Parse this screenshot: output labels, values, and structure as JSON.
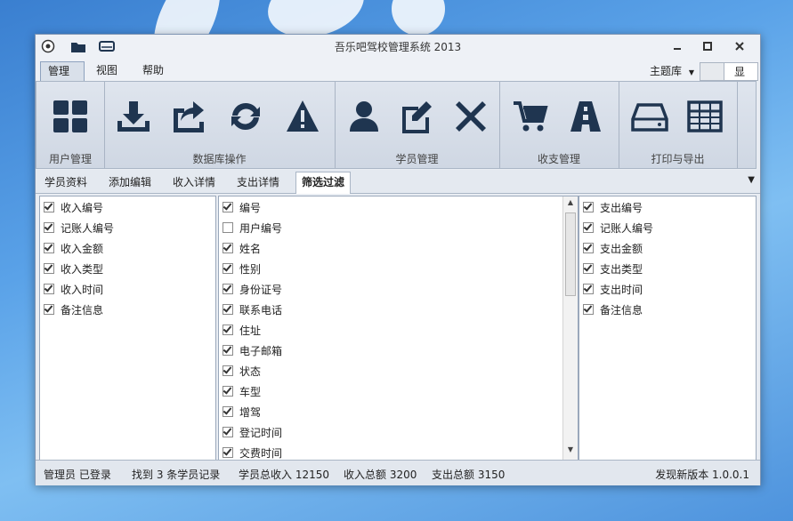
{
  "window": {
    "title": "吾乐吧驾校管理系统 2013"
  },
  "menu": {
    "tabs": [
      "管理",
      "视图",
      "帮助"
    ],
    "theme_label": "主题库",
    "theme_toggle": "显"
  },
  "ribbon": {
    "groups": [
      {
        "label": "用户管理",
        "icons": [
          "grid-icon"
        ]
      },
      {
        "label": "数据库操作",
        "icons": [
          "download-icon",
          "share-icon",
          "refresh-icon",
          "warning-icon"
        ]
      },
      {
        "label": "学员管理",
        "icons": [
          "user-icon",
          "edit-icon",
          "close-icon"
        ]
      },
      {
        "label": "收支管理",
        "icons": [
          "cart-icon",
          "road-icon"
        ]
      },
      {
        "label": "打印与导出",
        "icons": [
          "drive-icon",
          "table-icon"
        ]
      }
    ]
  },
  "tabs": [
    "学员资料",
    "添加编辑",
    "收入详情",
    "支出详情",
    "筛选过滤"
  ],
  "active_tab": "筛选过滤",
  "left_list": [
    {
      "label": "收入编号",
      "checked": true
    },
    {
      "label": "记账人编号",
      "checked": true
    },
    {
      "label": "收入金额",
      "checked": true
    },
    {
      "label": "收入类型",
      "checked": true
    },
    {
      "label": "收入时间",
      "checked": true
    },
    {
      "label": "备注信息",
      "checked": true
    }
  ],
  "middle_list": [
    {
      "label": "编号",
      "checked": true
    },
    {
      "label": "用户编号",
      "checked": false
    },
    {
      "label": "姓名",
      "checked": true
    },
    {
      "label": "性别",
      "checked": true
    },
    {
      "label": "身份证号",
      "checked": true
    },
    {
      "label": "联系电话",
      "checked": true
    },
    {
      "label": "住址",
      "checked": true
    },
    {
      "label": "电子邮箱",
      "checked": true
    },
    {
      "label": "状态",
      "checked": true
    },
    {
      "label": "车型",
      "checked": true
    },
    {
      "label": "增驾",
      "checked": true
    },
    {
      "label": "登记时间",
      "checked": true
    },
    {
      "label": "交费时间",
      "checked": true
    }
  ],
  "right_list": [
    {
      "label": "支出编号",
      "checked": true
    },
    {
      "label": "记账人编号",
      "checked": true
    },
    {
      "label": "支出金额",
      "checked": true
    },
    {
      "label": "支出类型",
      "checked": true
    },
    {
      "label": "支出时间",
      "checked": true
    },
    {
      "label": "备注信息",
      "checked": true
    }
  ],
  "status": {
    "login": "管理员 已登录",
    "found": "找到 3 条学员记录",
    "student_income": "学员总收入 12150",
    "income_total": "收入总额 3200",
    "expense_total": "支出总额 3150",
    "version": "发现新版本 1.0.0.1"
  },
  "colors": {
    "icon": "#1f3550",
    "accent": "#8ea2be"
  }
}
